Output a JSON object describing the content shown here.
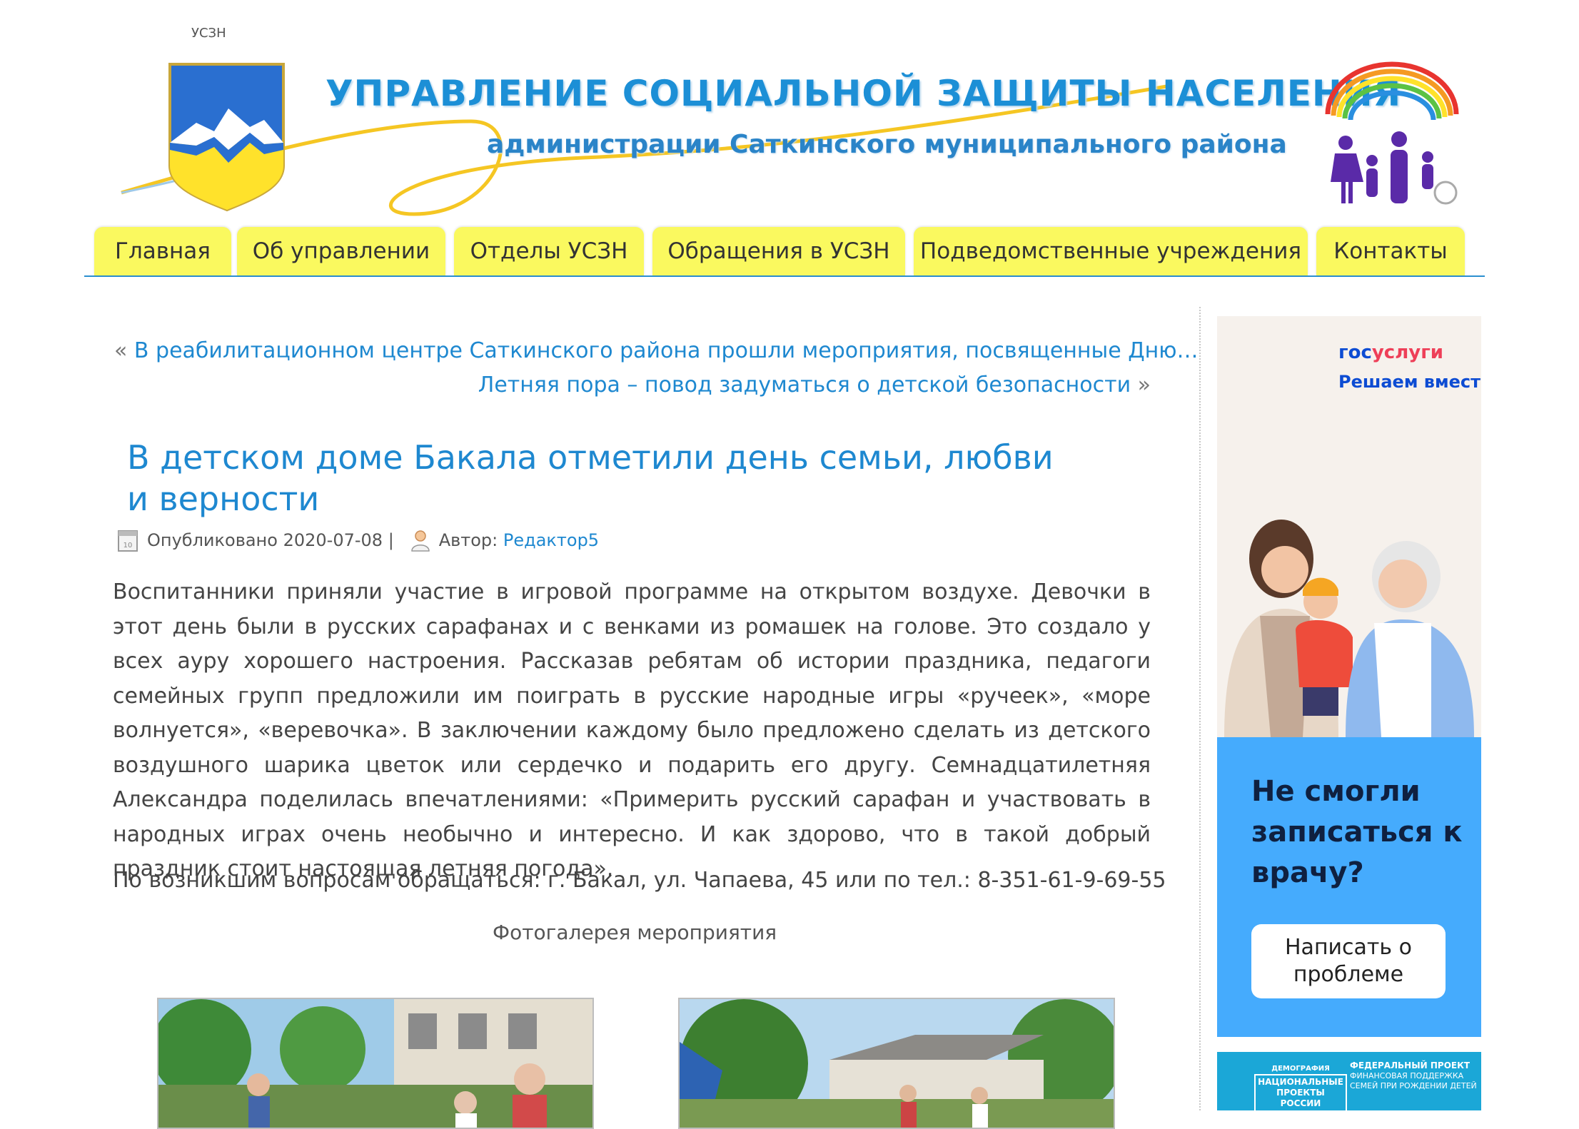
{
  "site": {
    "tag": "УСЗН",
    "title_main": "УПРАВЛЕНИЕ СОЦИАЛЬНОЙ ЗАЩИТЫ НАСЕЛЕНИЯ",
    "title_sub": "администрации Саткинского муниципального района"
  },
  "nav": {
    "items": [
      {
        "label": "Главная"
      },
      {
        "label": "Об управлении"
      },
      {
        "label": "Отделы УСЗН"
      },
      {
        "label": "Обращения в УСЗН"
      },
      {
        "label": "Подведомственные учреждения"
      },
      {
        "label": "Контакты"
      }
    ]
  },
  "post_nav": {
    "prev_arrow": "«",
    "prev": "В реабилитационном центре Саткинского района прошли мероприятия, посвященные Дню…",
    "next": "Летняя пора – повод задуматься о детской безопасности",
    "next_arrow": "»"
  },
  "post": {
    "title": "В детском доме Бакала отметили день семьи, любви и верности",
    "published_label": "Опубликовано",
    "date": "2020-07-08",
    "separator": "|",
    "author_label": "Автор:",
    "author": "Редактор5",
    "body": "Воспитанники приняли участие в игровой программе на открытом воздухе. Девочки в этот день были в русских сарафанах и с венками из ромашек на голове. Это создало у всех ауру хорошего настроения. Рассказав ребятам об истории праздника, педагоги семейных групп предложили им поиграть в русские  народные игры «ручеек», «море волнуется», «веревочка». В заключении каждому было предложено сделать из детского воздушного шарика цветок или сердечко и подарить его другу. Семнадцатилетняя Александра поделилась впечатлениями: «Примерить русский сарафан и участвовать в народных играх очень необычно и интересно. И как здорово, что в такой добрый праздник стоит настоящая летняя погода».",
    "contact": "По возникшим вопросам обращаться: г. Бакал, ул. Чапаева, 45 или по тел.: 8-351-61-9-69-55",
    "gallery_caption": "Фотогалерея мероприятия"
  },
  "sidebar": {
    "gosuslugi": {
      "logo_gos": "гос",
      "logo_uslugi": "услуги",
      "tagline": "Решаем вместе",
      "headline": "Не смогли записаться к врачу?",
      "button": "Написать о проблеме"
    },
    "banner2": {
      "left_small": "ДЕМОГРАФИЯ",
      "left_big": "НАЦИОНАЛЬНЫЕ ПРОЕКТЫ РОССИИ",
      "right_title": "ФЕДЕРАЛЬНЫЙ ПРОЕКТ",
      "right_text": "ФИНАНСОВАЯ ПОДДЕРЖКА СЕМЕЙ ПРИ РОЖДЕНИИ ДЕТЕЙ"
    }
  },
  "colors": {
    "link": "#1e88d0",
    "nav_tab": "#faf95f",
    "nav_line": "#2c8fcf",
    "banner_blue": "#45abfd"
  }
}
